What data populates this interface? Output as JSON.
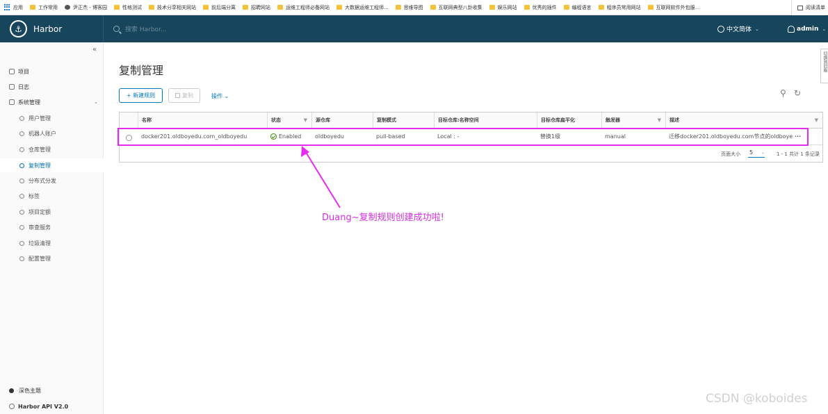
{
  "bookmarks": {
    "items": [
      {
        "label": "应用",
        "type": "apps"
      },
      {
        "label": "工作常用",
        "type": "folder"
      },
      {
        "label": "尹正杰 - 博客园",
        "type": "site"
      },
      {
        "label": "性格测试",
        "type": "folder"
      },
      {
        "label": "技术分享相关网站",
        "type": "folder"
      },
      {
        "label": "前后端分离",
        "type": "folder"
      },
      {
        "label": "招聘网站",
        "type": "folder"
      },
      {
        "label": "运维工程师必备网站",
        "type": "folder"
      },
      {
        "label": "大数据运维工程师...",
        "type": "folder"
      },
      {
        "label": "思维导图",
        "type": "folder"
      },
      {
        "label": "互联网典型八卦收集",
        "type": "folder"
      },
      {
        "label": "娱乐网站",
        "type": "folder"
      },
      {
        "label": "优秀的插件",
        "type": "folder"
      },
      {
        "label": "编程语言",
        "type": "folder"
      },
      {
        "label": "程序员常用网站",
        "type": "folder"
      },
      {
        "label": "互联网软件外包服...",
        "type": "folder"
      }
    ],
    "reading_list": "阅读清单"
  },
  "header": {
    "brand": "Harbor",
    "search_placeholder": "搜索 Harbor...",
    "language": "中文简体",
    "user": "admin"
  },
  "sidebar": {
    "collapse_glyph": "«",
    "items": [
      {
        "label": "项目"
      },
      {
        "label": "日志"
      },
      {
        "label": "系统管理"
      }
    ],
    "sub_items": [
      {
        "label": "用户管理"
      },
      {
        "label": "机器人账户"
      },
      {
        "label": "仓库管理"
      },
      {
        "label": "复制管理",
        "active": true
      },
      {
        "label": "分布式分发"
      },
      {
        "label": "标签"
      },
      {
        "label": "项目定额"
      },
      {
        "label": "审查服务"
      },
      {
        "label": "垃圾清理"
      },
      {
        "label": "配置管理"
      }
    ],
    "dark_theme": "深色主题",
    "api": "Harbor API V2.0"
  },
  "main": {
    "title": "复制管理",
    "new_rule_label": "+ 新建规则",
    "copy_label": "复制",
    "ops_label": "操作",
    "columns": [
      "名称",
      "状态",
      "源仓库",
      "复制模式",
      "目标仓库:名称空间",
      "目标仓库扁平化",
      "触发器",
      "描述"
    ],
    "rows": [
      {
        "name": "docker201.oldboyedu.com_oldboyedu",
        "status": "Enabled",
        "source": "oldboyedu",
        "mode": "pull-based",
        "dest_namespace": "Local : -",
        "flatten": "替换1级",
        "trigger": "manual",
        "description": "迁移docker201.oldboyedu.com节点的oldboye"
      }
    ],
    "pagination": {
      "page_size_label": "页面大小",
      "page_size": "5",
      "info": "1 - 1 共计 1 条记录"
    }
  },
  "annotation": {
    "text": "Duang~复制规则创建成功啦!",
    "color": "#e62bf0"
  },
  "right_strip": "切换到旧版",
  "watermark": "CSDN @koboides"
}
